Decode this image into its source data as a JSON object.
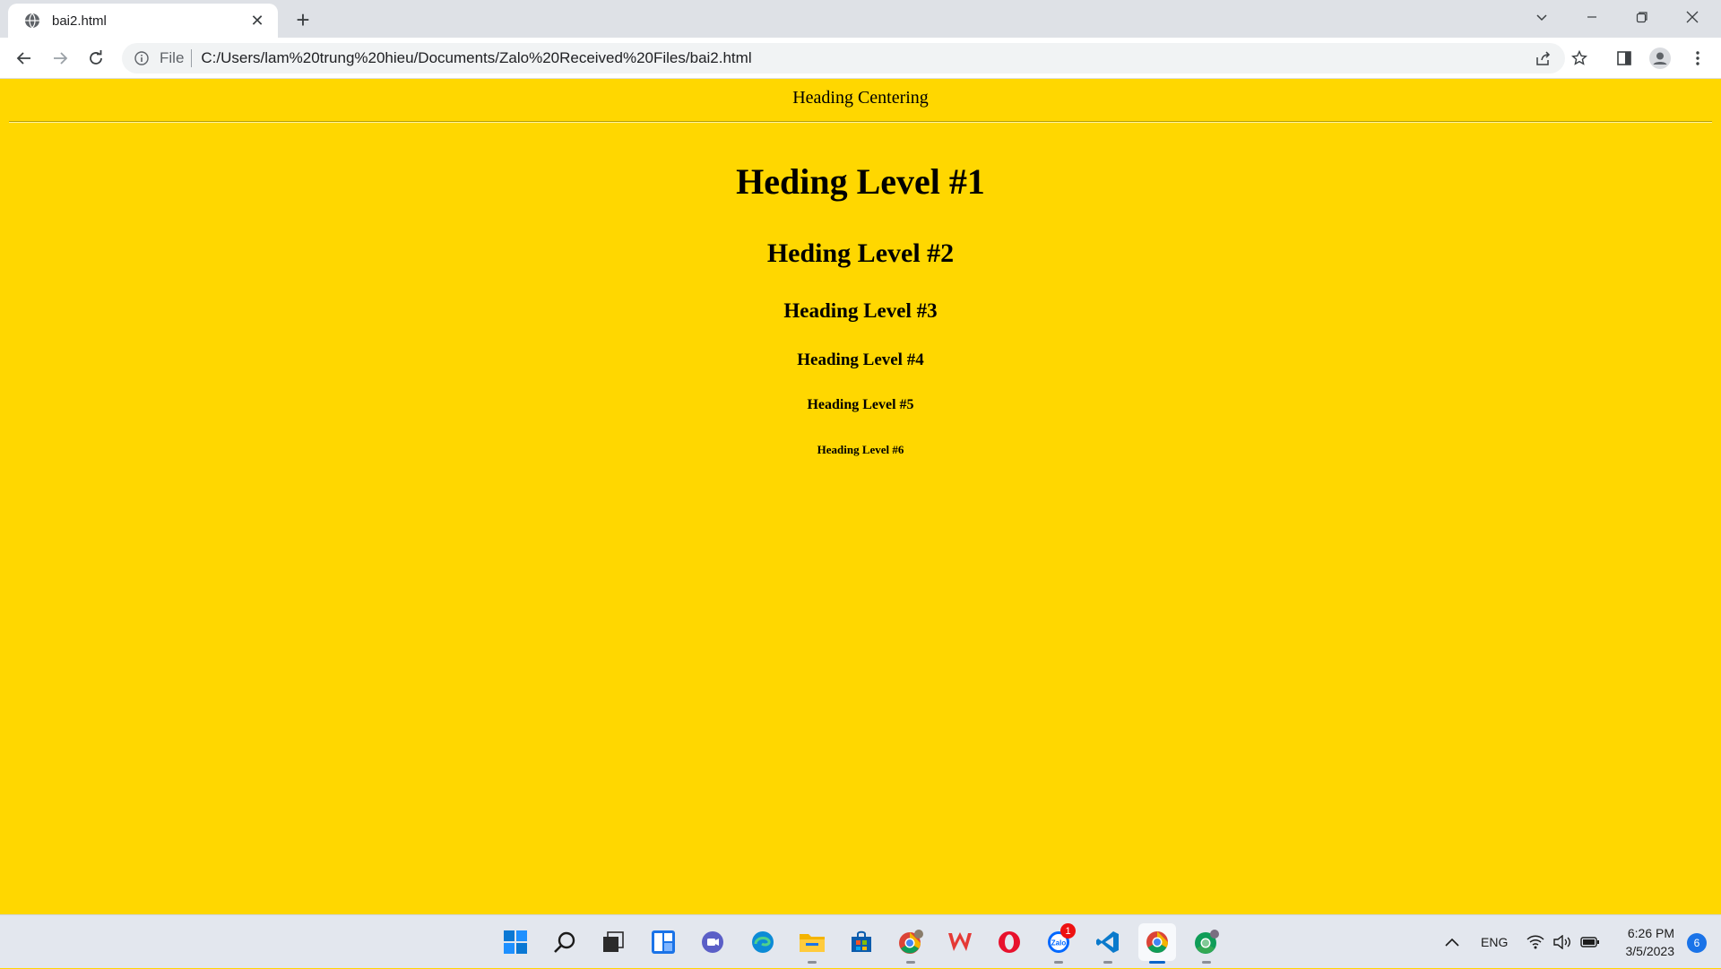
{
  "browser": {
    "tab": {
      "title": "bai2.html"
    },
    "address": {
      "scheme": "File",
      "url": "C:/Users/lam%20trung%20hieu/Documents/Zalo%20Received%20Files/bai2.html"
    }
  },
  "page": {
    "banner": "Heading Centering",
    "headings": {
      "h1": "Heding Level #1",
      "h2": "Heding Level #2",
      "h3": "Heading Level #3",
      "h4": "Heading Level #4",
      "h5": "Heading Level #5",
      "h6": "Heading Level #6"
    },
    "background_color": "#ffd700"
  },
  "taskbar": {
    "apps": [
      "start-icon",
      "search-icon",
      "task-view-icon",
      "widgets-icon",
      "chat-icon",
      "edge-icon",
      "file-explorer-icon",
      "store-icon",
      "chrome-profile-icon",
      "wps-icon",
      "opera-icon",
      "zalo-icon",
      "vscode-icon",
      "chrome-icon",
      "chrome-profile-2-icon"
    ],
    "zalo_badge": "1",
    "tray": {
      "language": "ENG"
    },
    "clock": {
      "time": "6:26 PM",
      "date": "3/5/2023"
    },
    "notifications": "6"
  }
}
